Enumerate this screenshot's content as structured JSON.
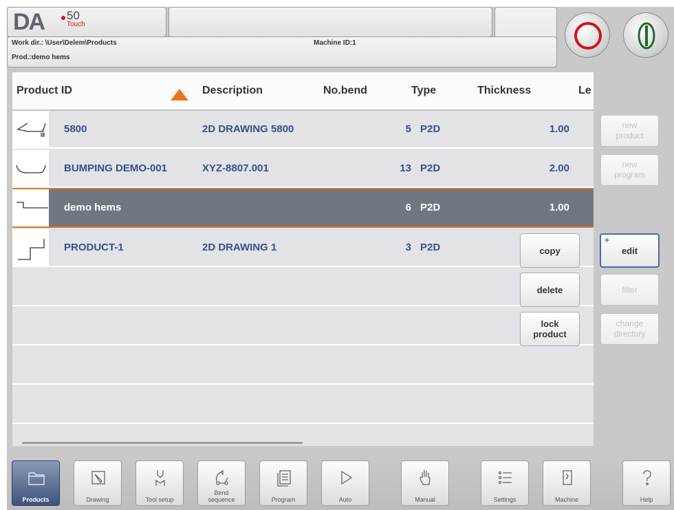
{
  "header": {
    "logo_text": "DA",
    "version": "50",
    "edition": "Touch",
    "work_dir": "Work dir.: \\User\\Delem\\Products",
    "product": "Prod.:demo hems",
    "machine_id": "Machine ID:1"
  },
  "power_buttons": {
    "stop_icon": "stop-circle-icon",
    "start_icon": "start-line-icon"
  },
  "table": {
    "columns": [
      "Product ID",
      "Description",
      "No.bend",
      "Type",
      "Thickness",
      "Le"
    ],
    "sort_icon": "sort-up-arrow-icon",
    "rows": [
      {
        "product_id": "5800",
        "description": "2D DRAWING 5800",
        "no_bend": "5",
        "type": "P2D",
        "thickness": "1.00",
        "locked": true
      },
      {
        "product_id": "BUMPING DEMO-001",
        "description": "XYZ-8807.001",
        "no_bend": "13",
        "type": "P2D",
        "thickness": "2.00",
        "locked": false
      },
      {
        "product_id": "demo hems",
        "description": "",
        "no_bend": "6",
        "type": "P2D",
        "thickness": "1.00",
        "locked": false,
        "selected": true
      },
      {
        "product_id": "PRODUCT-1",
        "description": "2D DRAWING 1",
        "no_bend": "3",
        "type": "P2D",
        "thickness": "",
        "locked": false
      }
    ]
  },
  "side_buttons": {
    "new_product": "new\nproduct",
    "new_program": "new\nprogram",
    "copy": "copy",
    "edit": "edit",
    "edit_mark": "+",
    "delete": "delete",
    "filter": "filter",
    "lock_product": "lock\nproduct",
    "change_directory": "change\ndirectory"
  },
  "nav": [
    {
      "label": "Products",
      "icon": "folder-icon",
      "active": true
    },
    {
      "label": "Drawing",
      "icon": "drawing-icon",
      "active": false
    },
    {
      "label": "Tool setup",
      "icon": "tool-setup-icon",
      "active": false
    },
    {
      "label": "Bend\nsequence",
      "icon": "bend-sequence-icon",
      "active": false
    },
    {
      "label": "Program",
      "icon": "program-icon",
      "active": false
    },
    {
      "label": "Auto",
      "icon": "play-icon",
      "active": false
    },
    {
      "label": "Manual",
      "icon": "hand-icon",
      "active": false
    },
    {
      "label": "Settings",
      "icon": "settings-list-icon",
      "active": false
    },
    {
      "label": "Machine",
      "icon": "machine-icon",
      "active": false
    },
    {
      "label": "Help",
      "icon": "help-icon",
      "active": false
    }
  ],
  "colors": {
    "accent": "#e8761c",
    "selected_row": "#6f7880",
    "text_blue": "#3a4f86",
    "stop_red": "#d3121b",
    "start_green": "#1f6b2a"
  }
}
